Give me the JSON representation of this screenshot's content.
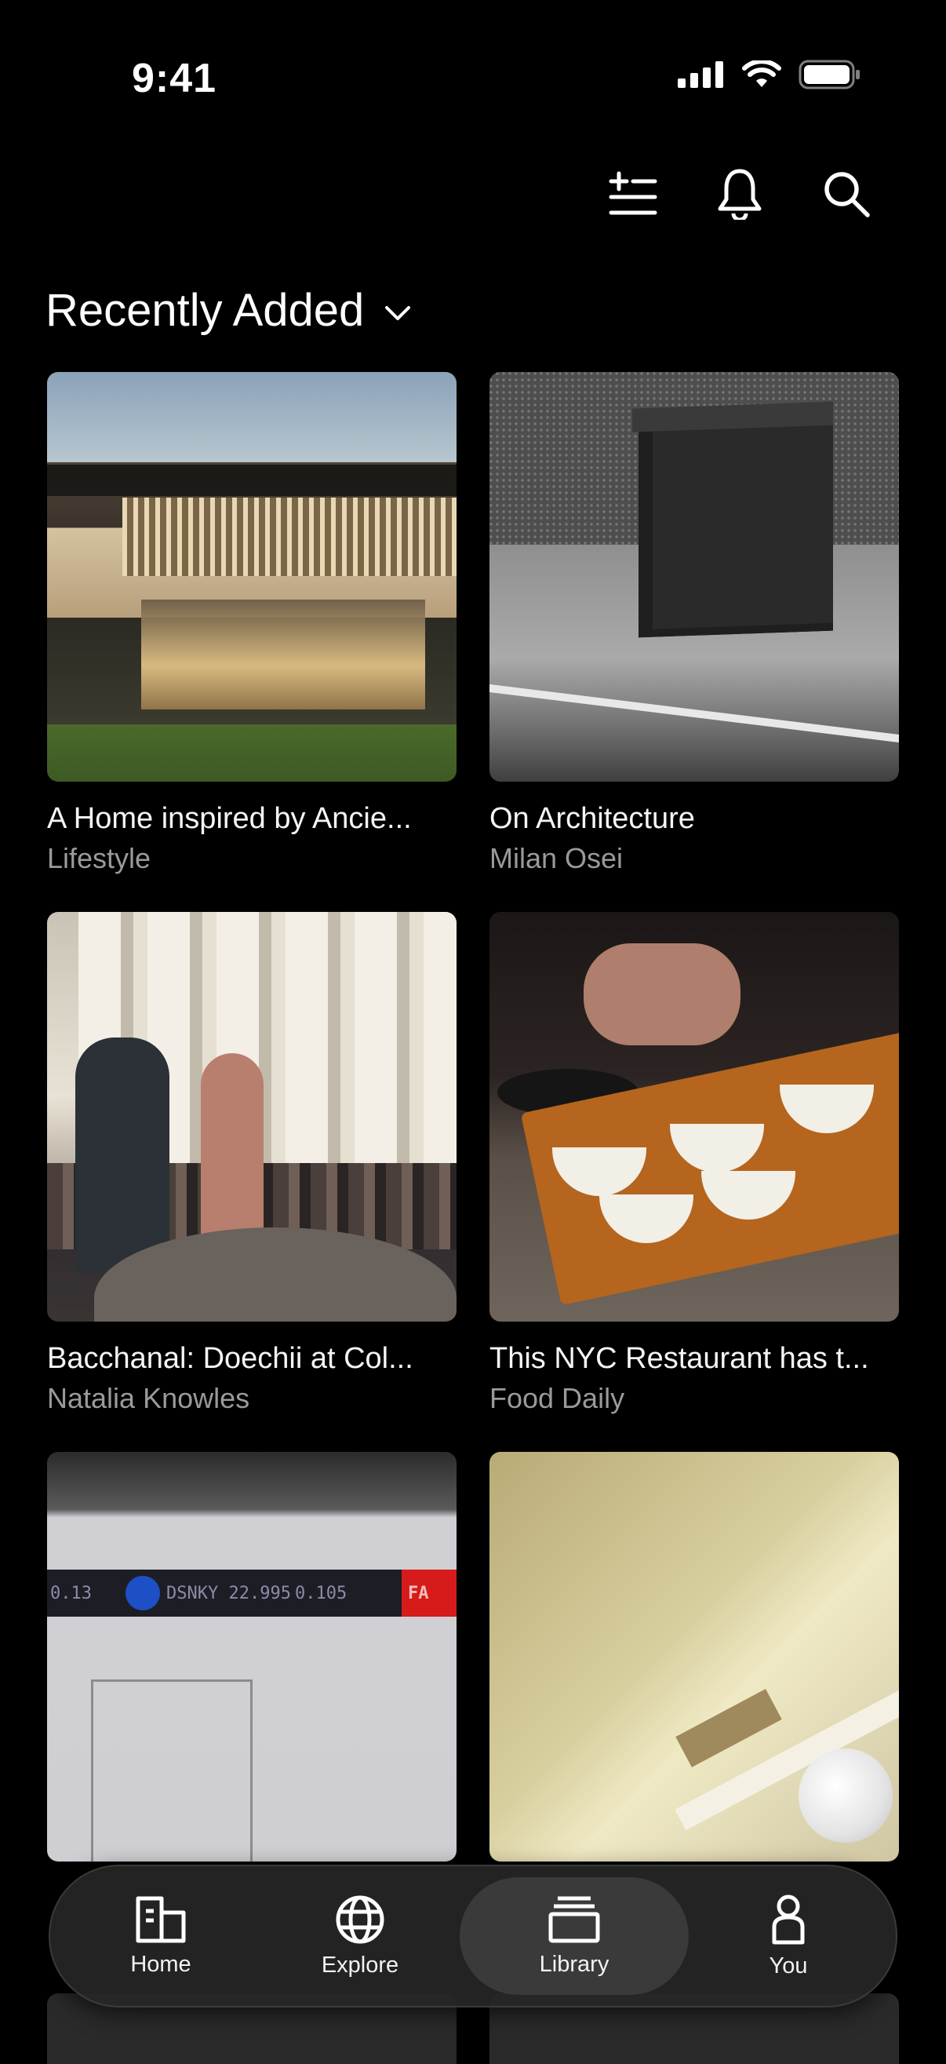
{
  "status_bar": {
    "time": "9:41"
  },
  "header": {
    "icons": [
      "add-to-list-icon",
      "bell-icon",
      "search-icon"
    ]
  },
  "section": {
    "title": "Recently Added"
  },
  "cards": [
    {
      "title": "A Home inspired by Ancie...",
      "subtitle": "Lifestyle"
    },
    {
      "title": "On Architecture",
      "subtitle": "Milan Osei"
    },
    {
      "title": "Bacchanal: Doechii at Col...",
      "subtitle": "Natalia Knowles"
    },
    {
      "title": "This NYC Restaurant has t...",
      "subtitle": "Food Daily"
    },
    {
      "title": "",
      "subtitle": ""
    },
    {
      "title": "",
      "subtitle": ""
    }
  ],
  "thumb_text": {
    "ticker_left": "0.13",
    "ticker_mid": "DSNKY 22.995",
    "ticker_right": "0.105",
    "ticker_brand": "FA"
  },
  "tabbar": {
    "items": [
      {
        "label": "Home",
        "icon": "building-icon"
      },
      {
        "label": "Explore",
        "icon": "globe-icon"
      },
      {
        "label": "Library",
        "icon": "stack-icon",
        "active": true
      },
      {
        "label": "You",
        "icon": "person-icon"
      }
    ]
  },
  "colors": {
    "background": "#000000",
    "secondary_text": "#9a9a9a",
    "tabbar": "#262626",
    "active_tab": "#3a3a3a"
  }
}
